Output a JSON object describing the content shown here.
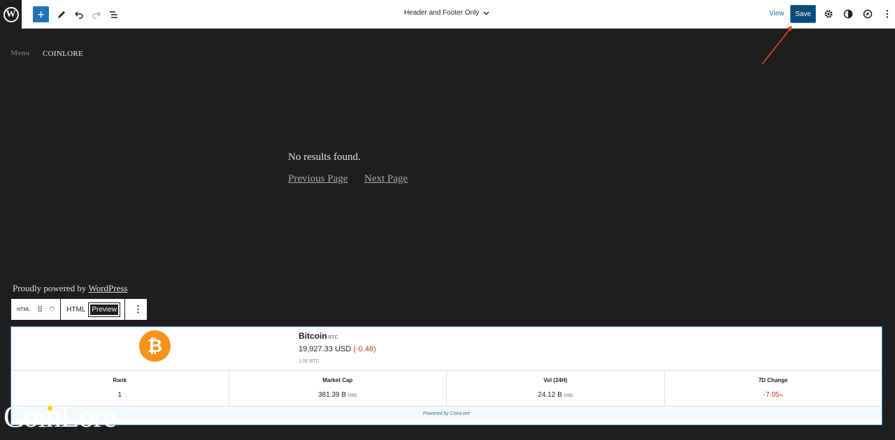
{
  "toolbar": {
    "document_title": "Header and Footer Only",
    "view_label": "View",
    "save_label": "Save",
    "add_symbol": "+"
  },
  "canvas": {
    "menu_label": "Menu",
    "site_name": "COINLORE",
    "no_results": "No results found.",
    "previous_page": "Previous Page",
    "next_page": "Next Page",
    "powered_prefix": "Proudly powered by ",
    "powered_link": "WordPress"
  },
  "block_toolbar": {
    "block_type": "HTML",
    "html_tab": "HTML",
    "preview_tab": "Preview"
  },
  "widget": {
    "coin_symbol_glyph": "₿",
    "coin_name": "Bitcoin",
    "coin_ticker": "BTC",
    "price": "19,927.33 USD",
    "price_change": "(-0.48)",
    "quantity": "1.00 BTC",
    "stats": [
      {
        "label": "Rank",
        "value": "1",
        "unit": ""
      },
      {
        "label": "Market Cap",
        "value": "381.39 B",
        "unit": "USD"
      },
      {
        "label": "Vol (24H)",
        "value": "24.12 B",
        "unit": "USD"
      },
      {
        "label": "7D Change",
        "value": "-7.05",
        "unit": "%"
      }
    ],
    "footer": "Powered by CoinLore"
  },
  "watermark": "CoinLore",
  "colors": {
    "accent": "#2271b1",
    "save_button": "#0a4b78",
    "bitcoin_orange": "#f7931a",
    "negative": "#c0392b",
    "canvas_bg": "#1e1e1e",
    "arrow": "#e8442e"
  }
}
